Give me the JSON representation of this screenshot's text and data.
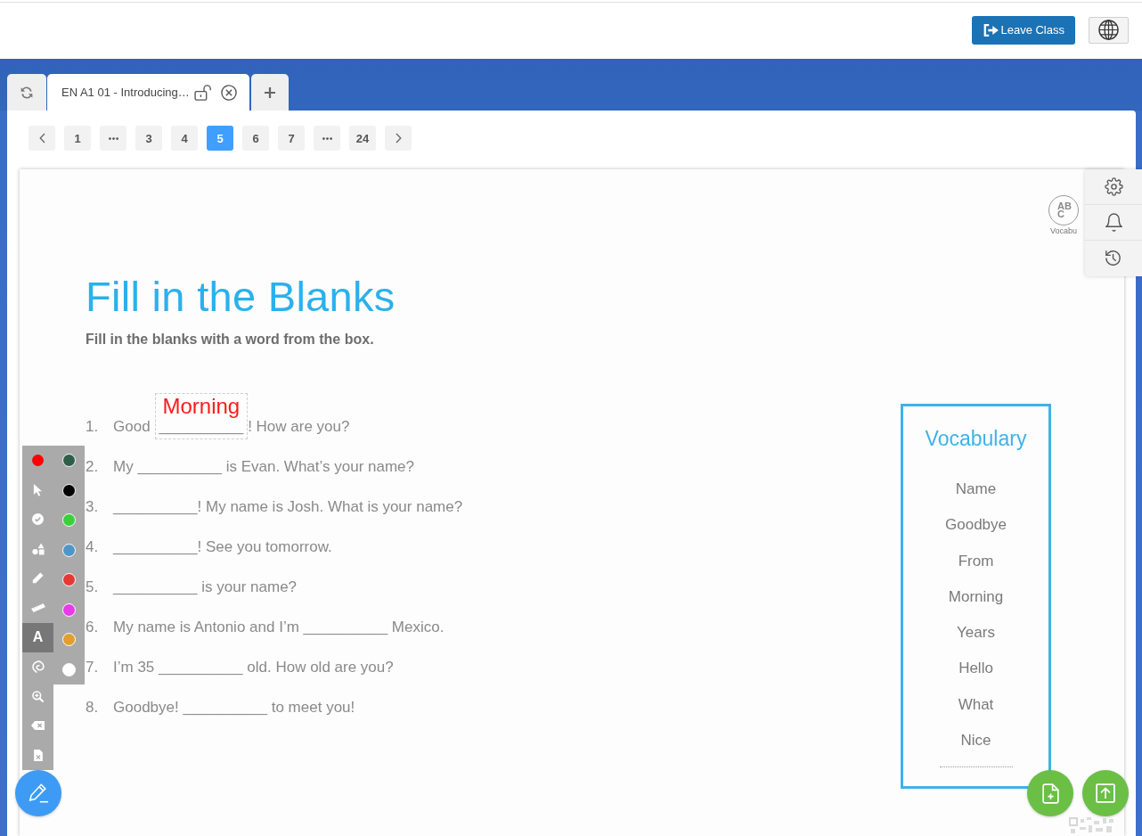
{
  "header": {
    "leave_button": "Leave Class"
  },
  "tab_bar": {
    "tabs": [
      {
        "label": "EN A1 01 - Introducing…",
        "locked": false,
        "selected": true
      }
    ]
  },
  "pagination": {
    "items": [
      {
        "kind": "prev",
        "selected": false
      },
      {
        "kind": "page",
        "label": "1",
        "selected": false
      },
      {
        "kind": "gap",
        "selected": false
      },
      {
        "kind": "page",
        "label": "3",
        "selected": false
      },
      {
        "kind": "page",
        "label": "4",
        "selected": false
      },
      {
        "kind": "page",
        "label": "5",
        "selected": true
      },
      {
        "kind": "page",
        "label": "6",
        "selected": false
      },
      {
        "kind": "page",
        "label": "7",
        "selected": false
      },
      {
        "kind": "gap",
        "selected": false
      },
      {
        "kind": "page",
        "label": "24",
        "selected": false
      },
      {
        "kind": "next",
        "selected": false
      }
    ]
  },
  "worksheet": {
    "badge": {
      "letters": "AB C",
      "caption": "Vocabu"
    },
    "title": "Fill in the Blanks",
    "instruction": "Fill in the blanks with a word from the box.",
    "questions": [
      {
        "number": "1.",
        "parts": [
          {
            "kind": "text",
            "text": "Good"
          },
          {
            "kind": "blank",
            "text": "__________",
            "answer": "Morning"
          },
          {
            "kind": "text",
            "text": "! How are you?"
          }
        ]
      },
      {
        "number": "2.",
        "parts": [
          {
            "kind": "text",
            "text": "My __________ is Evan. What’s your name?"
          }
        ]
      },
      {
        "number": "3.",
        "parts": [
          {
            "kind": "text",
            "text": "__________! My name is Josh. What is your name?"
          }
        ]
      },
      {
        "number": "4.",
        "parts": [
          {
            "kind": "text",
            "text": "__________! See you tomorrow."
          }
        ]
      },
      {
        "number": "5.",
        "parts": [
          {
            "kind": "text",
            "text": "__________ is your name?"
          }
        ]
      },
      {
        "number": "6.",
        "parts": [
          {
            "kind": "text",
            "text": "My name is Antonio and I’m __________ Mexico."
          }
        ]
      },
      {
        "number": "7.",
        "parts": [
          {
            "kind": "text",
            "text": "I’m 35 __________ old. How old are you?"
          }
        ]
      },
      {
        "number": "8.",
        "parts": [
          {
            "kind": "text",
            "text": "Goodbye! __________ to meet you!"
          }
        ]
      }
    ],
    "vocabulary": {
      "title": "Vocabulary",
      "words": [
        "Name",
        "Goodbye",
        "From",
        "Morning",
        "Years",
        "Hello",
        "What",
        "Nice"
      ]
    }
  },
  "toolbar": {
    "pen": {
      "color": "#ff0000"
    },
    "tools": [
      {
        "kind": "pointer",
        "selected": false
      },
      {
        "kind": "stamp",
        "selected": false
      },
      {
        "kind": "shapes",
        "selected": false
      },
      {
        "kind": "pencil",
        "selected": false
      },
      {
        "kind": "ruler",
        "selected": false
      },
      {
        "kind": "text",
        "glyph": "A",
        "selected": true
      },
      {
        "kind": "lasso",
        "selected": false
      },
      {
        "kind": "zoom",
        "selected": false
      },
      {
        "kind": "erase",
        "selected": false
      },
      {
        "kind": "clear",
        "selected": false
      }
    ],
    "palette": [
      {
        "color": "#2e5e48"
      },
      {
        "color": "#000000"
      },
      {
        "color": "#3ccf3c"
      },
      {
        "color": "#4f96c8"
      },
      {
        "color": "#e53935"
      },
      {
        "color": "#e83ae8"
      },
      {
        "color": "#e0a030"
      },
      {
        "color": "#ffffff"
      }
    ]
  }
}
